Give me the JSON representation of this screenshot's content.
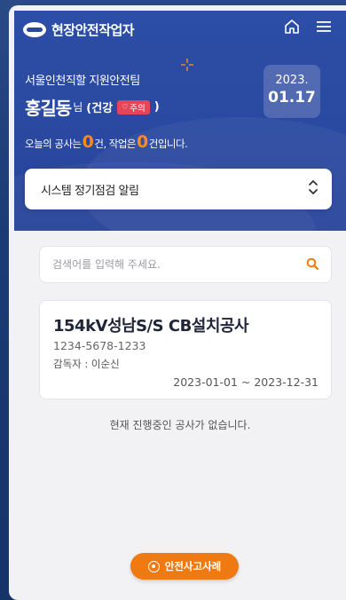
{
  "app": {
    "title": "현장안전작업자",
    "logo_alt": "KEPCO"
  },
  "icons": {
    "home": "home-icon",
    "menu": "menu-icon",
    "search": "search-icon",
    "chevron": "chevron-updown-icon",
    "sparkle": "sparkle-icon",
    "heart": "heart-icon",
    "safety": "target-icon"
  },
  "user": {
    "team": "서울인천직할 지원안전팀",
    "name": "홍길동",
    "suffix": "님",
    "health_label": "(건강",
    "health_status": "주의",
    "health_close": ")"
  },
  "date": {
    "year": "2023.",
    "month_day": "01.17"
  },
  "summary": {
    "prefix": "오늘의 공사는",
    "construction_count": "0",
    "mid": "건, 작업은",
    "work_count": "0",
    "suffix": "건입니다."
  },
  "notice": {
    "label": "시스템 정기점검 알림"
  },
  "search": {
    "placeholder": "검색어를 입력해 주세요."
  },
  "project": {
    "title": "154kV성남S/S CB설치공사",
    "code": "1234-5678-1233",
    "supervisor": "감독자 : 이순신",
    "period": "2023-01-01 ~ 2023-12-31"
  },
  "empty_message": "현재 진행중인 공사가 없습니다.",
  "cta": {
    "label": "안전사고사례"
  },
  "colors": {
    "primary": "#2a48a0",
    "accent": "#f07a12",
    "danger": "#e6445a"
  }
}
